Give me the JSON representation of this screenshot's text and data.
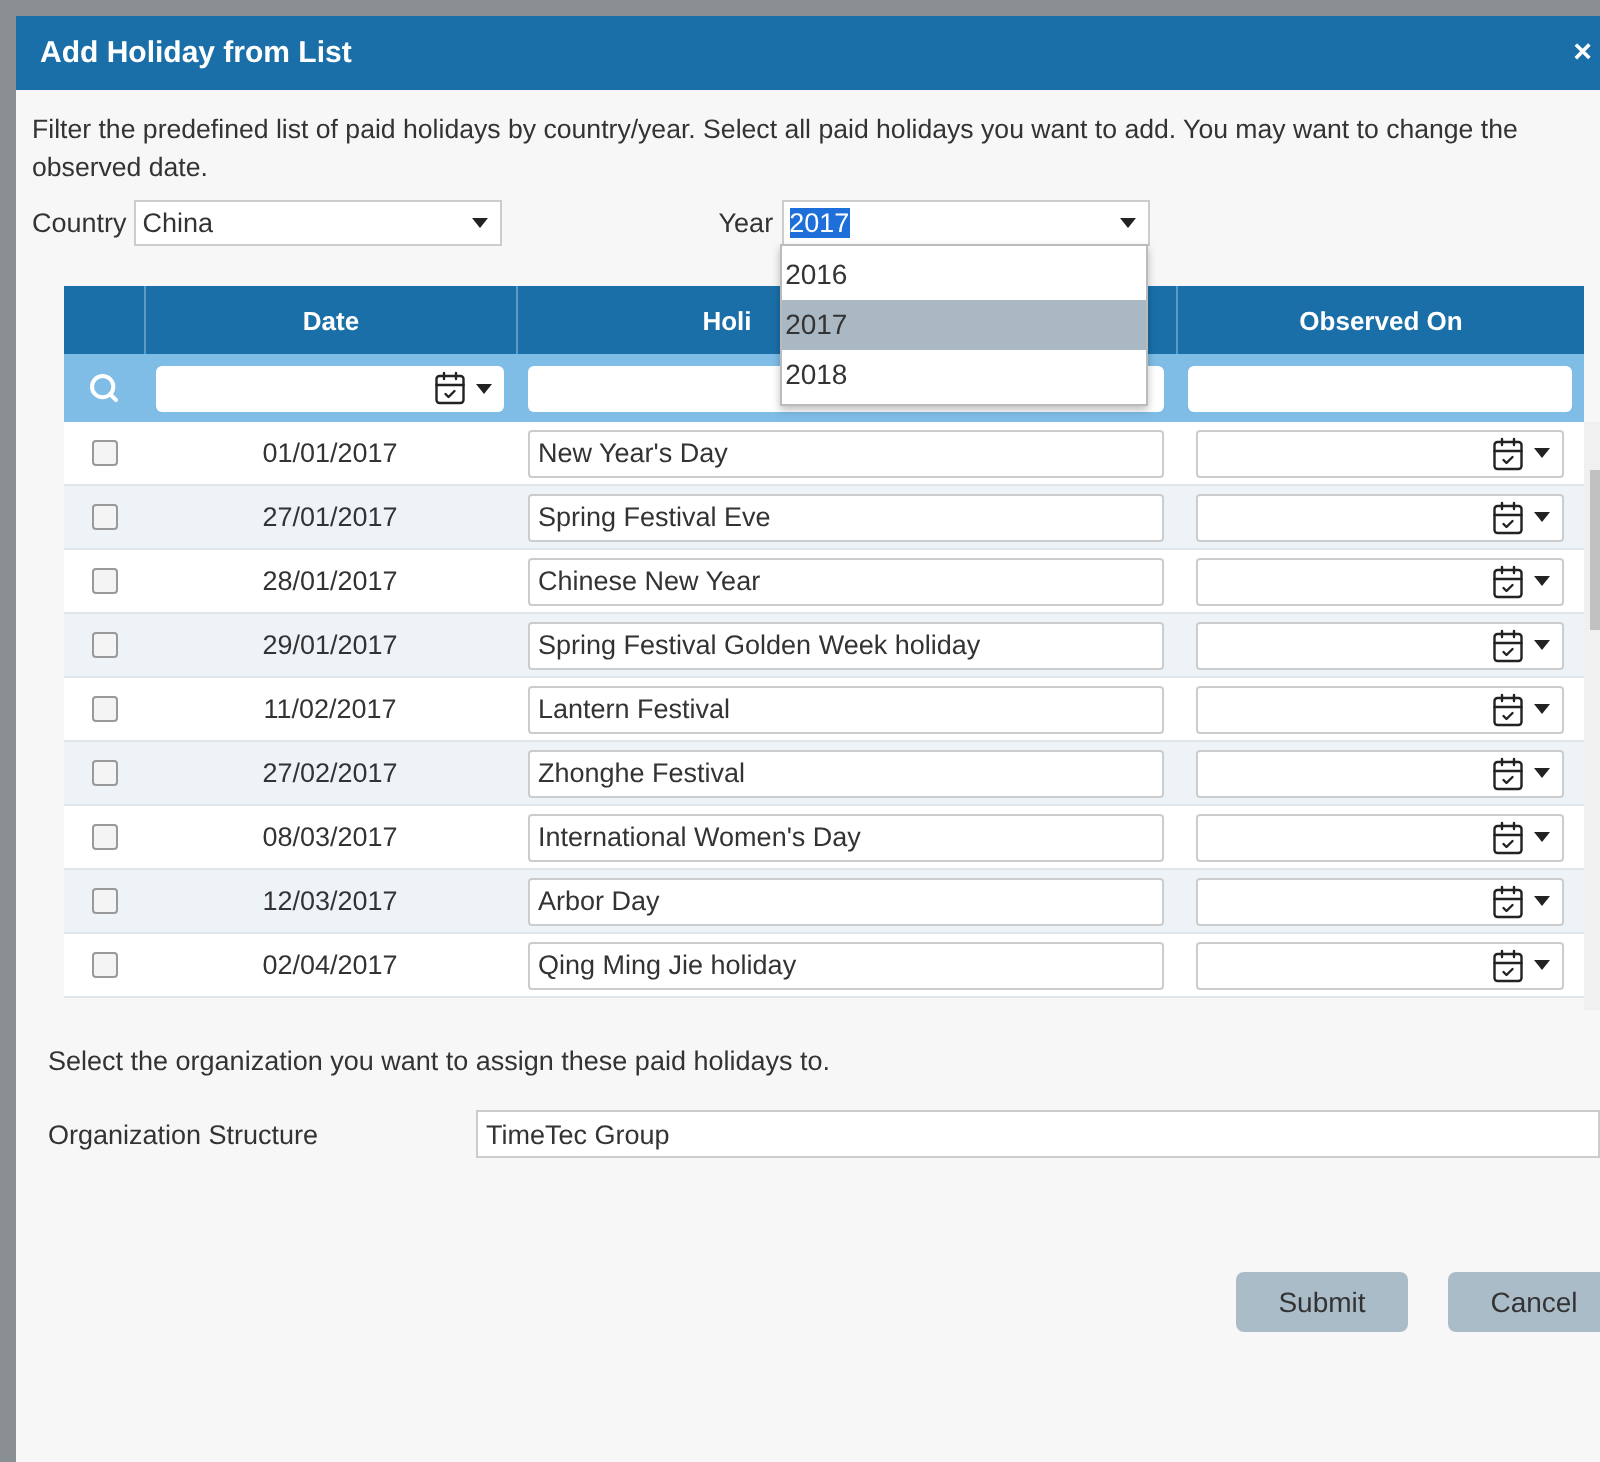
{
  "dialog": {
    "title": "Add Holiday from List",
    "close": "×"
  },
  "intro": "Filter the predefined list of paid holidays by country/year. Select all paid holidays you want to add. You may want to change the observed date.",
  "country": {
    "label": "Country",
    "value": "China"
  },
  "year": {
    "label": "Year",
    "value": "2017",
    "options": [
      {
        "label": "2016",
        "selected": false
      },
      {
        "label": "2017",
        "selected": true
      },
      {
        "label": "2018",
        "selected": false
      }
    ]
  },
  "table": {
    "columns": [
      "Date",
      "Holi",
      "Observed On"
    ],
    "rows": [
      {
        "checked": false,
        "date": "01/01/2017",
        "holiday": "New Year's Day"
      },
      {
        "checked": false,
        "date": "27/01/2017",
        "holiday": "Spring Festival Eve"
      },
      {
        "checked": false,
        "date": "28/01/2017",
        "holiday": "Chinese New Year"
      },
      {
        "checked": false,
        "date": "29/01/2017",
        "holiday": "Spring Festival Golden Week holiday"
      },
      {
        "checked": false,
        "date": "11/02/2017",
        "holiday": "Lantern Festival"
      },
      {
        "checked": false,
        "date": "27/02/2017",
        "holiday": "Zhonghe Festival"
      },
      {
        "checked": false,
        "date": "08/03/2017",
        "holiday": "International Women's Day"
      },
      {
        "checked": false,
        "date": "12/03/2017",
        "holiday": "Arbor Day"
      },
      {
        "checked": false,
        "date": "02/04/2017",
        "holiday": "Qing Ming Jie holiday"
      }
    ]
  },
  "org_prompt": "Select the organization you want to assign these paid holidays to.",
  "org": {
    "label": "Organization Structure",
    "value": "TimeTec Group"
  },
  "buttons": [
    "Submit",
    "Cancel"
  ]
}
